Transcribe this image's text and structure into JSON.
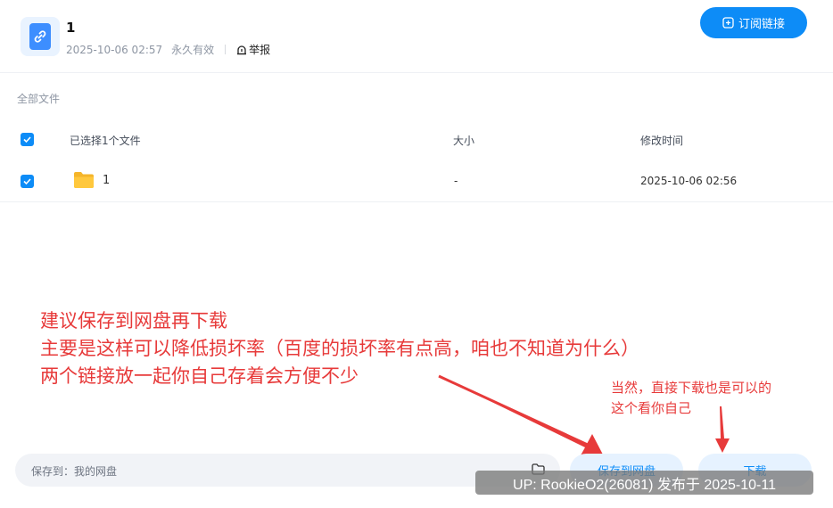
{
  "share": {
    "title": "1",
    "date": "2025-10-06 02:57",
    "validity": "永久有效",
    "report_label": "举报",
    "subscribe_label": "订阅链接"
  },
  "files": {
    "breadcrumb": "全部文件",
    "header": {
      "selected_label": "已选择1个文件",
      "size_label": "大小",
      "modified_label": "修改时间"
    },
    "rows": [
      {
        "name": "1",
        "size": "-",
        "modified": "2025-10-06 02:56",
        "checked": true
      }
    ]
  },
  "annotations": {
    "main": [
      "建议保存到网盘再下载",
      "主要是这样可以降低损坏率（百度的损坏率有点高，咱也不知道为什么）",
      "两个链接放一起你自己存着会方便不少"
    ],
    "side": [
      "当然，直接下载也是可以的",
      "这个看你自己"
    ]
  },
  "bottom": {
    "save_path_label": "保存到：我的网盘",
    "save_button": "保存到网盘",
    "download_button": "下载"
  },
  "watermark": "UP: RookieO2(26081) 发布于 2025-10-11",
  "colors": {
    "accent": "#0d8cf7",
    "annotation": "#e73a3a",
    "folder": "#ffc83d"
  }
}
